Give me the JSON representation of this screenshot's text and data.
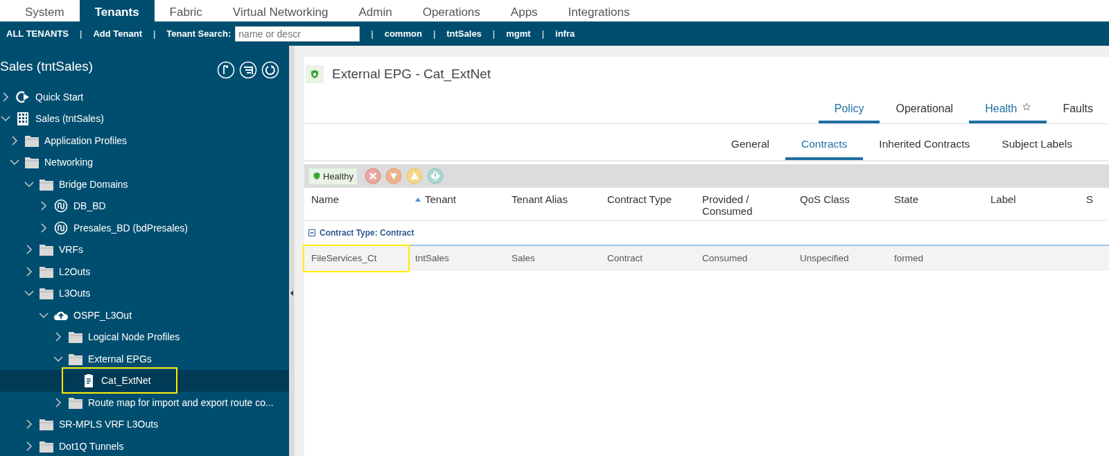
{
  "top_tabs": [
    {
      "label": "System",
      "selected": false
    },
    {
      "label": "Tenants",
      "selected": true
    },
    {
      "label": "Fabric",
      "selected": false
    },
    {
      "label": "Virtual Networking",
      "selected": false
    },
    {
      "label": "Admin",
      "selected": false
    },
    {
      "label": "Operations",
      "selected": false
    },
    {
      "label": "Apps",
      "selected": false
    },
    {
      "label": "Integrations",
      "selected": false
    }
  ],
  "tenant_bar": {
    "items": [
      {
        "kind": "link",
        "label": "ALL TENANTS"
      },
      {
        "kind": "sep",
        "label": "|"
      },
      {
        "kind": "link",
        "label": "Add Tenant"
      },
      {
        "kind": "sep",
        "label": "|"
      },
      {
        "kind": "search",
        "label": "Tenant Search:",
        "placeholder": "name or descr"
      },
      {
        "kind": "sep",
        "label": "|"
      },
      {
        "kind": "link",
        "label": "common"
      },
      {
        "kind": "sep",
        "label": "|"
      },
      {
        "kind": "link",
        "label": "tntSales"
      },
      {
        "kind": "sep",
        "label": "|"
      },
      {
        "kind": "link",
        "label": "mgmt"
      },
      {
        "kind": "sep",
        "label": "|"
      },
      {
        "kind": "link",
        "label": "infra"
      }
    ]
  },
  "sidebar": {
    "title": "Sales (tntSales)",
    "tree": [
      {
        "label": "Quick Start",
        "kind": "quickstart",
        "expanded": false,
        "selected": false,
        "highlighted": false
      },
      {
        "label": "Sales (tntSales)",
        "kind": "tenant",
        "expanded": true,
        "selected": false,
        "highlighted": false,
        "children": [
          {
            "label": "Application Profiles",
            "kind": "folder",
            "expanded": false,
            "selected": false,
            "highlighted": false
          },
          {
            "label": "Networking",
            "kind": "folder",
            "expanded": true,
            "selected": false,
            "highlighted": false,
            "children": [
              {
                "label": "Bridge Domains",
                "kind": "folder",
                "expanded": true,
                "selected": false,
                "highlighted": false,
                "children": [
                  {
                    "label": "DB_BD",
                    "kind": "bd",
                    "expanded": false,
                    "selected": false,
                    "highlighted": false
                  },
                  {
                    "label": "Presales_BD (bdPresales)",
                    "kind": "bd",
                    "expanded": false,
                    "selected": false,
                    "highlighted": false
                  }
                ]
              },
              {
                "label": "VRFs",
                "kind": "folder",
                "expanded": false,
                "selected": false,
                "highlighted": false
              },
              {
                "label": "L2Outs",
                "kind": "folder",
                "expanded": false,
                "selected": false,
                "highlighted": false
              },
              {
                "label": "L3Outs",
                "kind": "folder",
                "expanded": true,
                "selected": false,
                "highlighted": false,
                "children": [
                  {
                    "label": "OSPF_L3Out",
                    "kind": "cloud",
                    "expanded": true,
                    "selected": false,
                    "highlighted": false,
                    "children": [
                      {
                        "label": "Logical Node Profiles",
                        "kind": "folder",
                        "expanded": false,
                        "selected": false,
                        "highlighted": false
                      },
                      {
                        "label": "External EPGs",
                        "kind": "folder",
                        "expanded": true,
                        "selected": false,
                        "highlighted": false,
                        "children": [
                          {
                            "label": "Cat_ExtNet",
                            "kind": "epg",
                            "selected": true,
                            "highlighted": true
                          }
                        ]
                      },
                      {
                        "label": "Route map for import and export route co...",
                        "kind": "folder",
                        "expanded": false,
                        "selected": false,
                        "highlighted": false
                      }
                    ]
                  }
                ]
              },
              {
                "label": "SR-MPLS VRF L3Outs",
                "kind": "folder",
                "expanded": false,
                "selected": false,
                "highlighted": false
              },
              {
                "label": "Dot1Q Tunnels",
                "kind": "folder",
                "expanded": false,
                "selected": false,
                "highlighted": false
              }
            ]
          }
        ]
      }
    ]
  },
  "detail": {
    "title": "External EPG - Cat_ExtNet",
    "tabs": [
      {
        "label": "Policy",
        "selected": true
      },
      {
        "label": "Operational",
        "selected": false
      },
      {
        "label": "Health",
        "selected": true
      },
      {
        "label": "Faults",
        "selected": false
      }
    ],
    "subtabs": [
      {
        "label": "General",
        "selected": false
      },
      {
        "label": "Contracts",
        "selected": true
      },
      {
        "label": "Inherited Contracts",
        "selected": false
      },
      {
        "label": "Subject Labels",
        "selected": false
      }
    ],
    "health": "Healthy",
    "table": {
      "columns": [
        {
          "label": "Name",
          "sorted": false
        },
        {
          "label": "Tenant",
          "sorted": true
        },
        {
          "label": "Tenant Alias",
          "sorted": false
        },
        {
          "label": "Contract Type",
          "sorted": false
        },
        {
          "label": "Provided / Consumed",
          "sorted": false
        },
        {
          "label": "QoS Class",
          "sorted": false
        },
        {
          "label": "State",
          "sorted": false
        },
        {
          "label": "Label",
          "sorted": false
        },
        {
          "label": "S",
          "sorted": false
        }
      ],
      "group": "Contract Type: Contract",
      "rows": [
        {
          "cells": [
            {
              "text": "FileServices_Ct",
              "highlighted": true
            },
            {
              "text": "tntSales",
              "highlighted": false
            },
            {
              "text": "Sales",
              "highlighted": false
            },
            {
              "text": "Contract",
              "highlighted": false
            },
            {
              "text": "Consumed",
              "highlighted": false
            },
            {
              "text": "Unspecified",
              "highlighted": false
            },
            {
              "text": "formed",
              "highlighted": false
            }
          ]
        }
      ]
    }
  }
}
